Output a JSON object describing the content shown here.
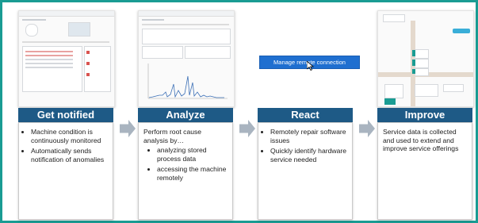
{
  "steps": [
    {
      "title": "Get notified",
      "bullets": [
        "Machine condition is continuously monitored",
        "Automatically sends notification of anomalies"
      ]
    },
    {
      "title": "Analyze",
      "intro": "Perform root cause analysis by…",
      "bullets": [
        "analyzing stored process data",
        "accessing the machine remotely"
      ]
    },
    {
      "title": "React",
      "button_label": "Manage remote connection",
      "bullets": [
        "Remotely repair software issues",
        "Quickly identify hardware service needed"
      ]
    },
    {
      "title": "Improve",
      "text": "Service data is collected and used to extend and improve service offerings"
    }
  ],
  "colors": {
    "frame": "#1a9c93",
    "header": "#1e5a86",
    "arrow": "#a9b4c0",
    "button": "#1f6fd0",
    "alert": "#d9534f",
    "teal_box": "#1a9c93"
  }
}
